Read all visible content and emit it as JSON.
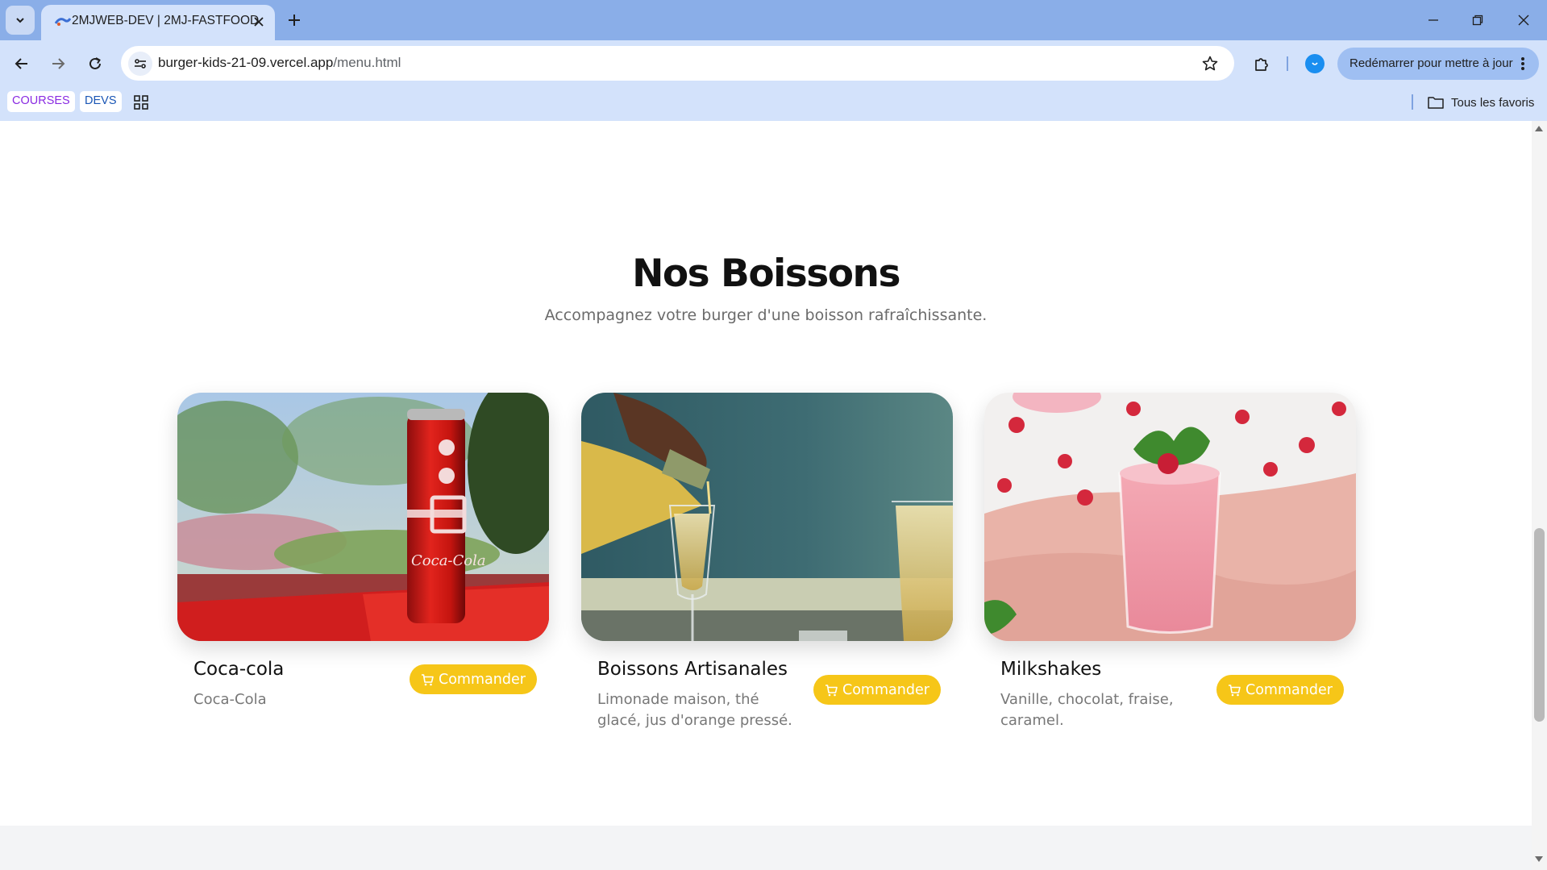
{
  "browser": {
    "tab_title": "2MJWEB-DEV | 2MJ-FASTFOOD",
    "url_domain": "burger-kids-21-09.vercel.app",
    "url_path": "/menu.html",
    "update_button": "Redémarrer pour mettre à jour",
    "bookmarks": [
      {
        "label": "COURSES",
        "color": "#8a2be2"
      },
      {
        "label": "DEVS",
        "color": "#1a56b5"
      }
    ],
    "all_bookmarks": "Tous les favoris",
    "chrome_color": "#d3e2fb",
    "tabbar_color": "#8aaee8"
  },
  "section": {
    "title": "Nos Boissons",
    "subtitle": "Accompagnez votre burger d'une boisson rafraîchissante."
  },
  "products": [
    {
      "name": "Coca-cola",
      "description": "Coca-Cola",
      "button": "Commander",
      "image": "coca-cola-can-photo"
    },
    {
      "name": "Boissons Artisanales",
      "description": "Limonade maison, thé glacé, jus d'orange pressé.",
      "button": "Commander",
      "image": "champagne-pour-photo"
    },
    {
      "name": "Milkshakes",
      "description": "Vanille, chocolat, fraise, caramel.",
      "button": "Commander",
      "image": "strawberry-milkshake-photo"
    }
  ],
  "theme": {
    "accent": "#f6c618"
  }
}
